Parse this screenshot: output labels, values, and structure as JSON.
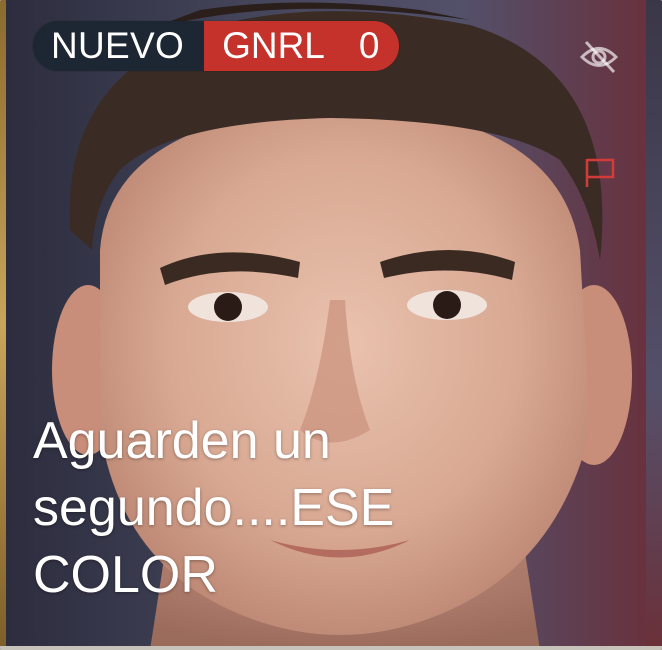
{
  "badge": {
    "label": "NUEVO",
    "category": "GNRL",
    "count": "0"
  },
  "caption": {
    "line1": "Aguarden un",
    "line2": "segundo....ESE",
    "line3": "COLOR"
  },
  "icons": {
    "hide": "eye-slash-icon",
    "flag": "flag-icon"
  },
  "colors": {
    "badge_dark": "#1c2733",
    "badge_red": "#c5312b",
    "flag_red": "#d33a3a"
  }
}
